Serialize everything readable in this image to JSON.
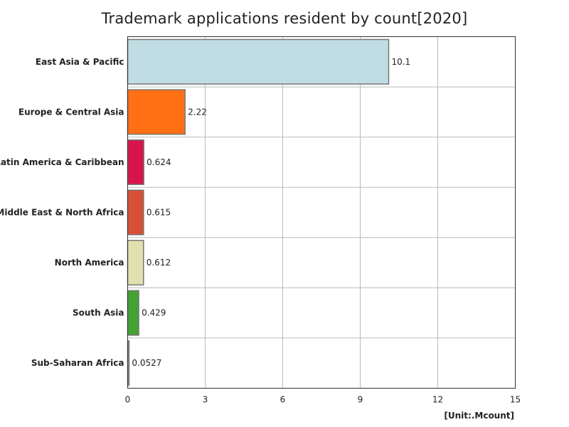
{
  "chart_data": {
    "type": "bar",
    "orientation": "horizontal",
    "title": "Trademark applications resident by count[2020]",
    "unit": "[Unit:.Mcount]",
    "categories": [
      "East Asia & Pacific",
      "Europe & Central Asia",
      "Latin America & Caribbean",
      "Middle East & North Africa",
      "North America",
      "South Asia",
      "Sub-Saharan Africa"
    ],
    "values": [
      10.1,
      2.22,
      0.624,
      0.615,
      0.612,
      0.429,
      0.0527
    ],
    "value_labels": [
      "10.1",
      "2.22",
      "0.624",
      "0.615",
      "0.612",
      "0.429",
      "0.0527"
    ],
    "colors": [
      "#c1dde4",
      "#ff6f14",
      "#d7154a",
      "#d65038",
      "#e1e1b0",
      "#44a233",
      "#999999"
    ],
    "xlim": [
      0,
      15
    ],
    "xticks": [
      0,
      3,
      6,
      9,
      12,
      15
    ],
    "grid": true,
    "legend": "none"
  }
}
